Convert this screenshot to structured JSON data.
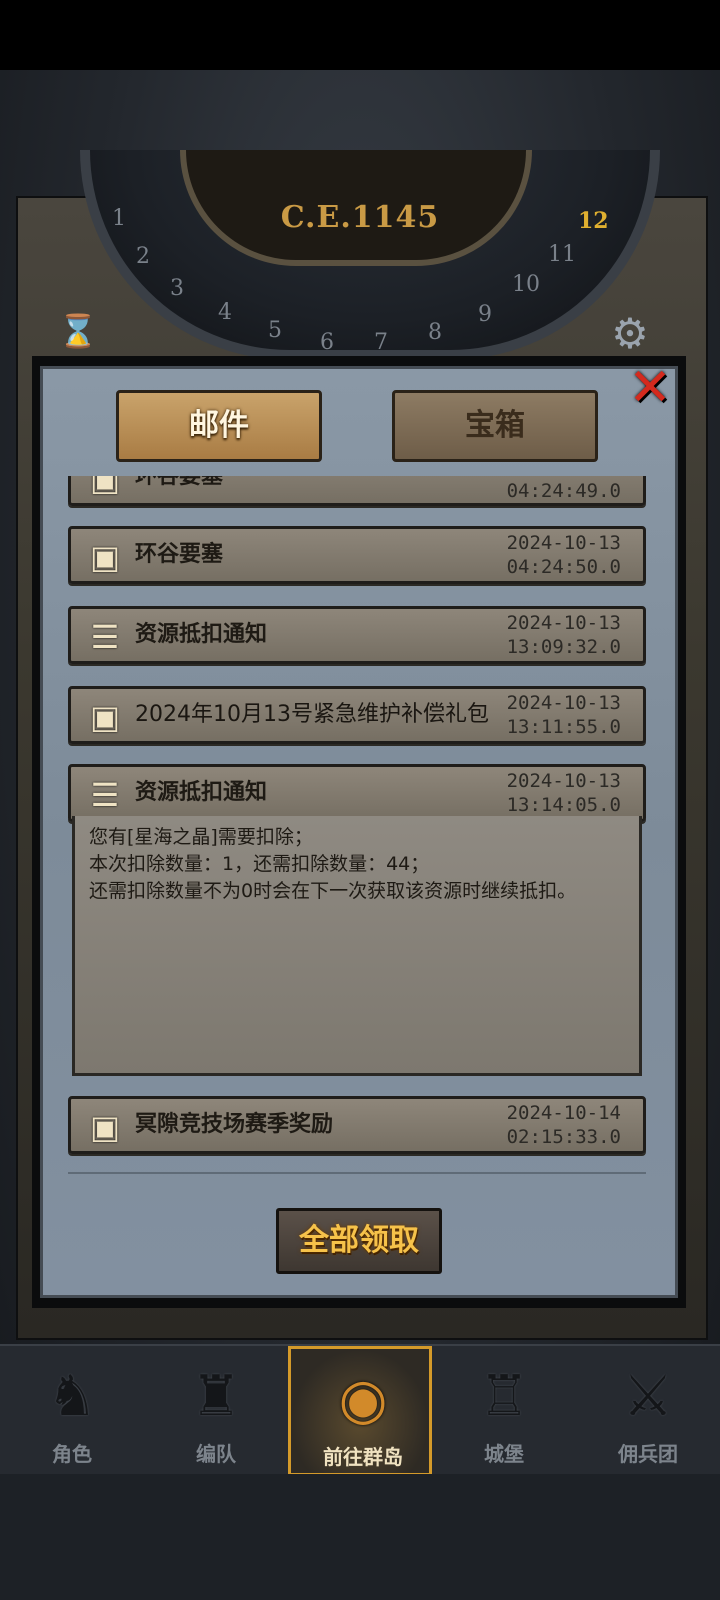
{
  "header": {
    "year": "C.E.1145",
    "dial_numbers": [
      "1",
      "2",
      "3",
      "4",
      "5",
      "6",
      "7",
      "8",
      "9",
      "10",
      "11",
      "12"
    ]
  },
  "tabs": [
    {
      "label": "邮件",
      "active": true
    },
    {
      "label": "宝箱",
      "active": false
    }
  ],
  "mail_rows": [
    {
      "icon": "chest-icon",
      "title": "环谷要塞",
      "date": "",
      "time": "04:24:49.0"
    },
    {
      "icon": "chest-icon",
      "title": "环谷要塞",
      "date": "2024-10-13",
      "time": "04:24:50.0"
    },
    {
      "icon": "scroll-icon",
      "title": "资源抵扣通知",
      "date": "2024-10-13",
      "time": "13:09:32.0"
    },
    {
      "icon": "chest-icon",
      "title": "2024年10月13号紧急维护补偿礼包",
      "date": "2024-10-13",
      "time": "13:11:55.0"
    },
    {
      "icon": "scroll-icon",
      "title": "资源抵扣通知",
      "date": "2024-10-13",
      "time": "13:14:05.0"
    },
    {
      "icon": "chest-icon",
      "title": "冥隙竞技场赛季奖励",
      "date": "2024-10-14",
      "time": "02:15:33.0"
    }
  ],
  "detail_lines": [
    "您有[星海之晶]需要扣除；",
    "本次扣除数量：1，还需扣除数量：44；",
    "还需扣除数量不为0时会在下一次获取该资源时继续抵扣。"
  ],
  "claim_all_label": "全部领取",
  "nav": [
    {
      "label": "角色",
      "icon": "knight-icon",
      "active": false
    },
    {
      "label": "编队",
      "icon": "team-icon",
      "active": false
    },
    {
      "label": "前往群岛",
      "icon": "globe-icon",
      "active": true
    },
    {
      "label": "城堡",
      "icon": "castle-icon",
      "active": false
    },
    {
      "label": "佣兵团",
      "icon": "mercenary-icon",
      "active": false
    }
  ],
  "colors": {
    "accent_gold": "#f6c24a",
    "close_red": "#d42a1e",
    "active_nav_border": "#d49a2a"
  }
}
